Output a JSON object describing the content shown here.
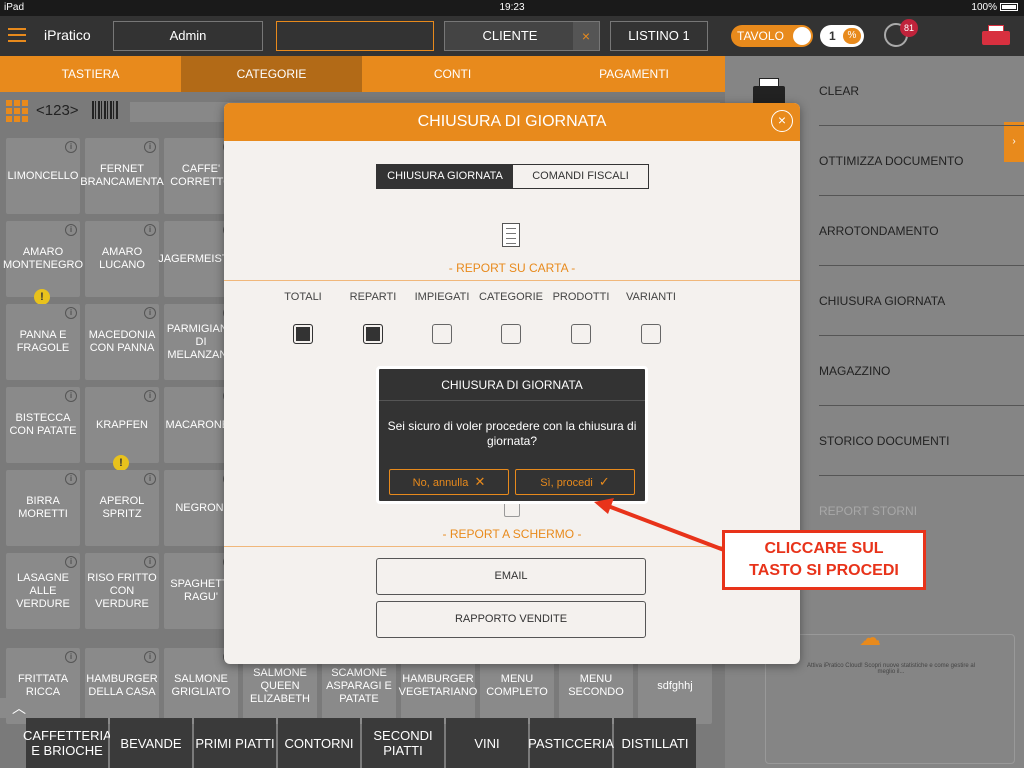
{
  "status": {
    "device": "iPad",
    "time": "19:23",
    "battery": "100%"
  },
  "topbar": {
    "logo": "iPratico",
    "operator": "Admin",
    "customer_label": "CLIENTE",
    "customer_clear": "×",
    "pricelist": "LISTINO 1",
    "tavolo_label": "TAVOLO",
    "quantity": "1",
    "percent": "%",
    "notifications": "81"
  },
  "tabs": [
    "TASTIERA",
    "CATEGORIE",
    "CONTI",
    "PAGAMENTI"
  ],
  "numpad_label": "<123>",
  "products": [
    {
      "name": "LIMONCELLO"
    },
    {
      "name": "FERNET BRANCAMENTA"
    },
    {
      "name": "CAFFE' CORRETTO"
    },
    {
      "name": "AMARO MONTENEGRO"
    },
    {
      "name": "AMARO LUCANO"
    },
    {
      "name": "JAGERMEISTER"
    },
    {
      "name": "PANNA E FRAGOLE"
    },
    {
      "name": "MACEDONIA CON PANNA"
    },
    {
      "name": "PARMIGIANA DI MELANZANE"
    },
    {
      "name": "BISTECCA CON PATATE"
    },
    {
      "name": "KRAPFEN"
    },
    {
      "name": "MACARONES"
    },
    {
      "name": "BIRRA MORETTI"
    },
    {
      "name": "APEROL SPRITZ"
    },
    {
      "name": "NEGRONI"
    },
    {
      "name": "LASAGNE ALLE VERDURE"
    },
    {
      "name": "RISO FRITTO CON VERDURE"
    },
    {
      "name": "SPAGHETTI RAGU'"
    },
    {
      "name": "FRITTATA RICCA"
    },
    {
      "name": "HAMBURGER DELLA CASA"
    },
    {
      "name": "SALMONE GRIGLIATO"
    },
    {
      "name": "SALMONE QUEEN ELIZABETH"
    },
    {
      "name": "SCAMONE ASPARAGI E PATATE"
    },
    {
      "name": "HAMBURGER VEGETARIANO"
    },
    {
      "name": "MENU COMPLETO"
    },
    {
      "name": "MENU SECONDO"
    },
    {
      "name": "sdfghhj"
    }
  ],
  "categories": [
    "CAFFETTERIA E BRIOCHE",
    "BEVANDE",
    "PRIMI PIATTI",
    "CONTORNI",
    "SECONDI PIATTI",
    "VINI",
    "PASTICCERIA",
    "DISTILLATI"
  ],
  "right_menu": [
    "CLEAR",
    "OTTIMIZZA DOCUMENTO",
    "ARROTONDAMENTO",
    "CHIUSURA GIORNATA",
    "MAGAZZINO",
    "STORICO DOCUMENTI",
    "REPORT STORNI"
  ],
  "cloud_text": "Attiva iPratico Cloud! Scopri nuove statistiche e come gestire al meglio il...",
  "modal": {
    "title": "CHIUSURA DI GIORNATA",
    "close": "×",
    "seg_a": "CHIUSURA GIORNATA",
    "seg_b": "COMANDI FISCALI",
    "report_paper": "- REPORT SU CARTA -",
    "columns": [
      "TOTALI",
      "REPARTI",
      "IMPIEGATI",
      "CATEGORIE",
      "PRODOTTI",
      "VARIANTI"
    ],
    "checked": [
      true,
      true,
      false,
      false,
      false,
      false
    ],
    "report_screen": "- REPORT A SCHERMO -",
    "btn_email": "EMAIL",
    "btn_sales": "RAPPORTO VENDITE"
  },
  "confirm": {
    "title": "CHIUSURA DI GIORNATA",
    "message": "Sei sicuro di voler procedere con la chiusura di giornata?",
    "cancel": "No, annulla",
    "cancel_icon": "✕",
    "ok": "Sì, procedi",
    "ok_icon": "✓"
  },
  "annotation": {
    "line1": "CLICCARE SUL",
    "line2": "TASTO SI PROCEDI"
  },
  "colors": {
    "accent": "#e88a1c",
    "annotation": "#e8331a"
  }
}
